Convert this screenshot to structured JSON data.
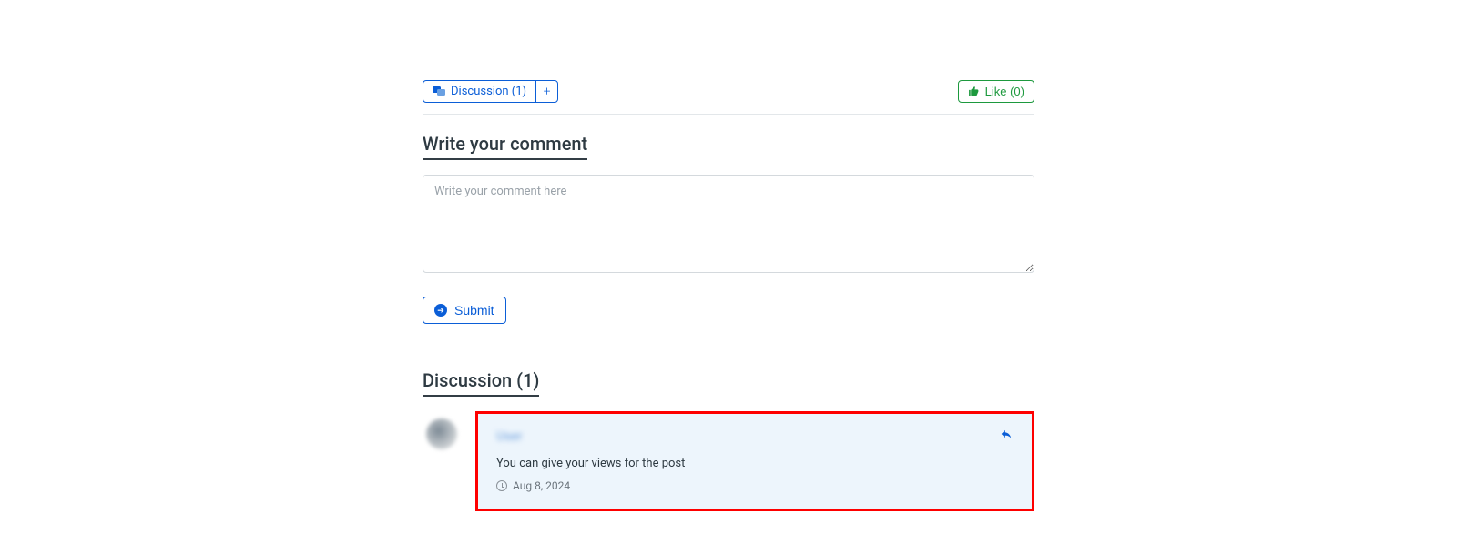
{
  "topbar": {
    "discussion_tab_label": "Discussion (1)",
    "like_label": "Like (0)"
  },
  "comment_form": {
    "heading": "Write your comment",
    "placeholder": "Write your comment here",
    "submit_label": "Submit"
  },
  "discussion": {
    "heading": "Discussion (1)",
    "posts": [
      {
        "author": "User",
        "body": "You can give your views for the post",
        "date": "Aug 8, 2024"
      }
    ]
  }
}
